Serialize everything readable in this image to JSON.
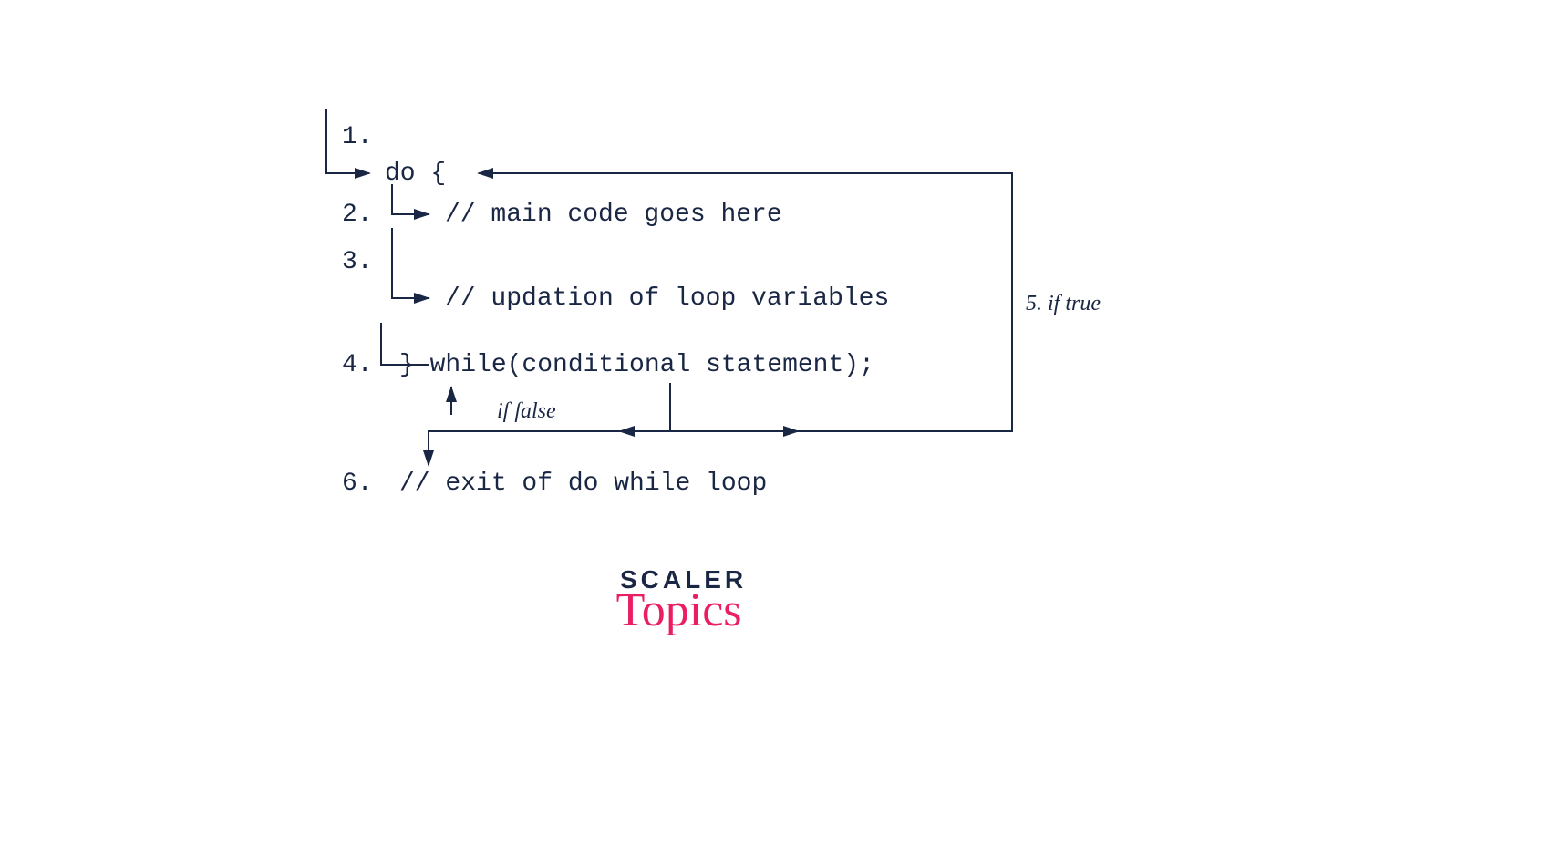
{
  "lines": {
    "n1": "1.",
    "n2": "2.",
    "n3": "3.",
    "n4": "4.",
    "n6": "6.",
    "do": "do {",
    "main": "// main code goes here",
    "update": "// updation of loop variables",
    "while": "} while(conditional statement);",
    "exit": "// exit of do while loop"
  },
  "labels": {
    "iftrue": "5. if true",
    "iffalse": "if false"
  },
  "logo": {
    "top": "SCALER",
    "bottom": "Topics"
  },
  "color": "#1a2744"
}
